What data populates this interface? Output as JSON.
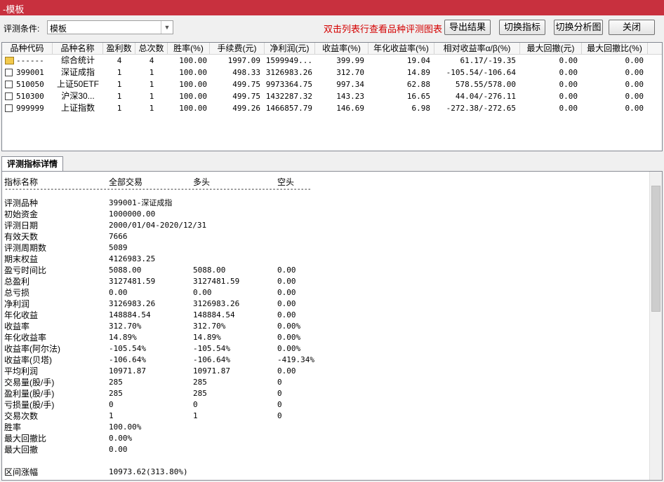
{
  "window": {
    "title": "-模板"
  },
  "toolbar": {
    "condition_label": "评测条件:",
    "condition_value": "模板",
    "hint": "双击列表行查看品种评测图表",
    "buttons": [
      "导出结果",
      "切换指标",
      "切换分析图",
      "关闭"
    ]
  },
  "grid": {
    "columns": [
      "品种代码",
      "品种名称",
      "盈利数",
      "总次数",
      "胜率(%)",
      "手续费(元)",
      "净利润(元)",
      "收益率(%)",
      "年化收益率(%)",
      "相对收益率α/β(%)",
      "最大回撤(元)",
      "最大回撤比(%)"
    ],
    "rows": [
      {
        "icon": "folder-icon",
        "code": "------",
        "name": "综合统计",
        "win": "4",
        "total": "4",
        "rate": "100.00",
        "fee": "1997.09",
        "profit": "1599949...",
        "ret": "399.99",
        "annual": "19.04",
        "rel": "61.17/-19.35",
        "dd": "0.00",
        "ddr": "0.00"
      },
      {
        "icon": "file-icon",
        "code": "399001",
        "name": "深证成指",
        "win": "1",
        "total": "1",
        "rate": "100.00",
        "fee": "498.33",
        "profit": "3126983.26",
        "ret": "312.70",
        "annual": "14.89",
        "rel": "-105.54/-106.64",
        "dd": "0.00",
        "ddr": "0.00"
      },
      {
        "icon": "file-icon",
        "code": "510050",
        "name": "上证50ETF",
        "win": "1",
        "total": "1",
        "rate": "100.00",
        "fee": "499.75",
        "profit": "9973364.75",
        "ret": "997.34",
        "annual": "62.88",
        "rel": "578.55/578.00",
        "dd": "0.00",
        "ddr": "0.00"
      },
      {
        "icon": "file-icon",
        "code": "510300",
        "name": "沪深30...",
        "win": "1",
        "total": "1",
        "rate": "100.00",
        "fee": "499.75",
        "profit": "1432287.32",
        "ret": "143.23",
        "annual": "16.65",
        "rel": "44.04/-276.11",
        "dd": "0.00",
        "ddr": "0.00"
      },
      {
        "icon": "file-icon",
        "code": "999999",
        "name": "上证指数",
        "win": "1",
        "total": "1",
        "rate": "100.00",
        "fee": "499.26",
        "profit": "1466857.79",
        "ret": "146.69",
        "annual": "6.98",
        "rel": "-272.38/-272.65",
        "dd": "0.00",
        "ddr": "0.00"
      }
    ]
  },
  "detail": {
    "tab": "评测指标详情",
    "headers": [
      "指标名称",
      "全部交易",
      "多头",
      "空头"
    ],
    "separator": "--------------------------------------------------------------------------------------------",
    "rows": [
      {
        "name": "评测品种",
        "all": "399001-深证成指",
        "long": "",
        "short": ""
      },
      {
        "name": "初始资金",
        "all": "1000000.00",
        "long": "",
        "short": ""
      },
      {
        "name": "评测日期",
        "all": "2000/01/04-2020/12/31",
        "long": "",
        "short": ""
      },
      {
        "name": "有效天数",
        "all": "7666",
        "long": "",
        "short": ""
      },
      {
        "name": "评测周期数",
        "all": "5089",
        "long": "",
        "short": ""
      },
      {
        "name": "期末权益",
        "all": "4126983.25",
        "long": "",
        "short": ""
      },
      {
        "name": "盈亏时间比",
        "all": "5088.00",
        "long": "5088.00",
        "short": "0.00"
      },
      {
        "name": "总盈利",
        "all": "3127481.59",
        "long": "3127481.59",
        "short": "0.00"
      },
      {
        "name": "总亏损",
        "all": "0.00",
        "long": "0.00",
        "short": "0.00"
      },
      {
        "name": "净利润",
        "all": "3126983.26",
        "long": "3126983.26",
        "short": "0.00"
      },
      {
        "name": "年化收益",
        "all": "148884.54",
        "long": "148884.54",
        "short": "0.00"
      },
      {
        "name": "收益率",
        "all": "312.70%",
        "long": "312.70%",
        "short": "0.00%"
      },
      {
        "name": "年化收益率",
        "all": "14.89%",
        "long": "14.89%",
        "short": "0.00%"
      },
      {
        "name": "收益率(阿尔法)",
        "all": "-105.54%",
        "long": "-105.54%",
        "short": "0.00%"
      },
      {
        "name": "收益率(贝塔)",
        "all": "-106.64%",
        "long": "-106.64%",
        "short": "-419.34%"
      },
      {
        "name": "平均利润",
        "all": "10971.87",
        "long": "10971.87",
        "short": "0.00"
      },
      {
        "name": "交易量(股/手)",
        "all": "285",
        "long": "285",
        "short": "0"
      },
      {
        "name": "盈利量(股/手)",
        "all": "285",
        "long": "285",
        "short": "0"
      },
      {
        "name": "亏损量(股/手)",
        "all": "0",
        "long": "0",
        "short": "0"
      },
      {
        "name": "交易次数",
        "all": "1",
        "long": "1",
        "short": "0"
      },
      {
        "name": "胜率",
        "all": "100.00%",
        "long": "",
        "short": ""
      },
      {
        "name": "最大回撤比",
        "all": "0.00%",
        "long": "",
        "short": ""
      },
      {
        "name": "最大回撤",
        "all": "0.00",
        "long": "",
        "short": ""
      },
      {
        "name": "",
        "all": "",
        "long": "",
        "short": ""
      },
      {
        "name": "区间涨幅",
        "all": "10973.62(313.80%)",
        "long": "",
        "short": ""
      }
    ]
  }
}
